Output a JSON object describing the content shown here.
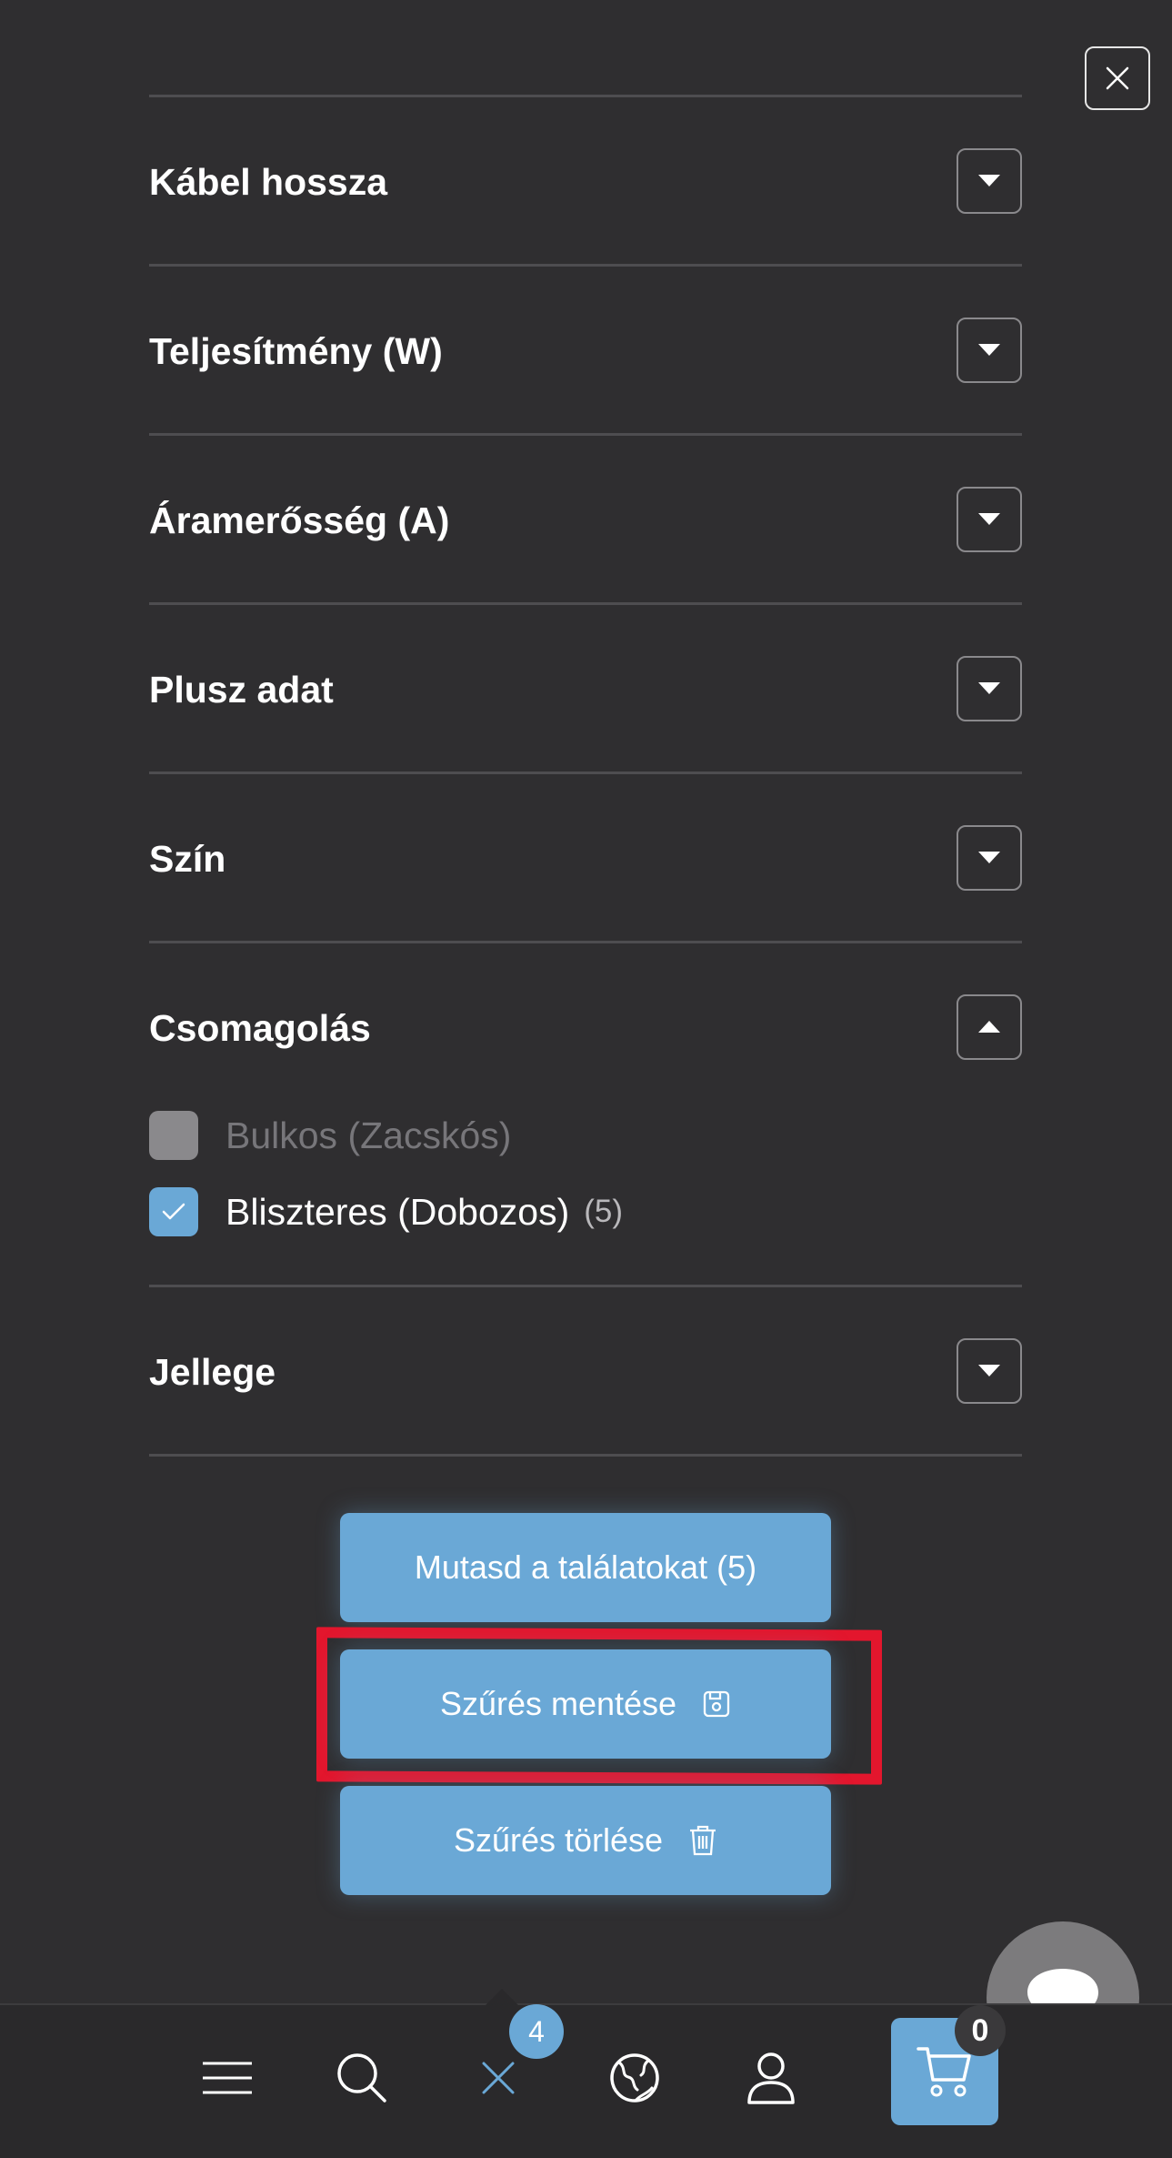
{
  "filters": [
    {
      "title": "Kábel hossza",
      "expanded": false
    },
    {
      "title": "Teljesítmény (W)",
      "expanded": false
    },
    {
      "title": "Áramerősség (A)",
      "expanded": false
    },
    {
      "title": "Plusz adat",
      "expanded": false
    },
    {
      "title": "Szín",
      "expanded": false
    },
    {
      "title": "Csomagolás",
      "expanded": true,
      "options": [
        {
          "label": "Bulkos (Zacskós)",
          "checked": false,
          "count": ""
        },
        {
          "label": "Bliszteres (Dobozos)",
          "checked": true,
          "count": "(5)"
        }
      ]
    },
    {
      "title": "Jellege",
      "expanded": false
    }
  ],
  "actions": {
    "show_results": "Mutasd a találatokat (5)",
    "save_filter": "Szűrés mentése",
    "clear_filter": "Szűrés törlése"
  },
  "bottom_nav": {
    "items": [
      "menu-icon",
      "search-icon",
      "filter-close-icon",
      "globe-icon",
      "user-icon",
      "cart-icon"
    ],
    "filter_count": "4",
    "cart_count": "0"
  },
  "colors": {
    "background": "#2f2e30",
    "accent": "#6aa8d6",
    "highlight": "#e3162d"
  }
}
